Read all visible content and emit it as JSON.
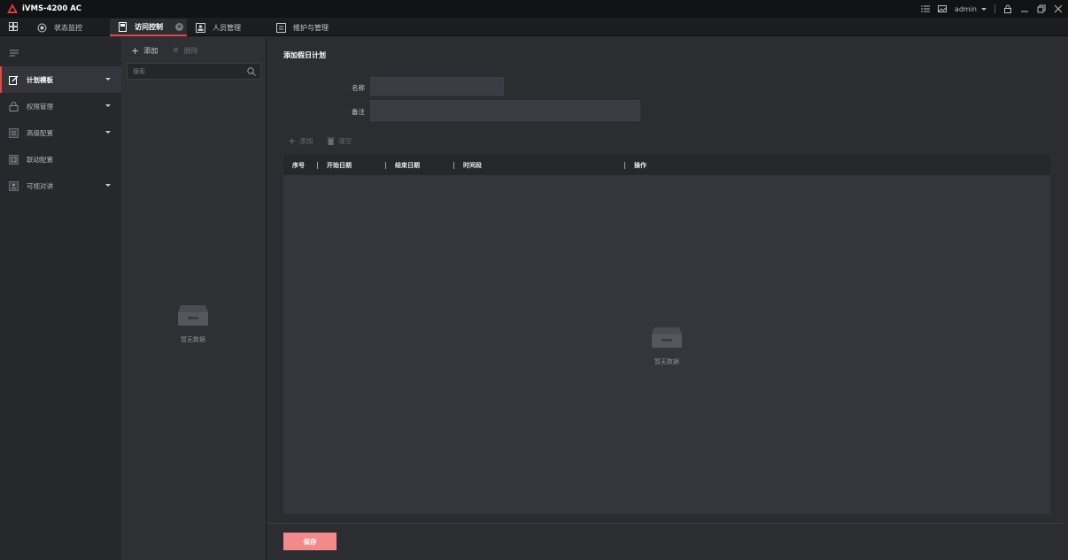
{
  "app": {
    "title": "iVMS-4200 AC",
    "user": "admin"
  },
  "tabs": [
    {
      "label": "状态监控",
      "icon": "monitor-icon"
    },
    {
      "label": "访问控制",
      "icon": "access-control-icon",
      "active": true
    },
    {
      "label": "人员管理",
      "icon": "person-icon"
    },
    {
      "label": "维护与管理",
      "icon": "maintenance-icon"
    }
  ],
  "sidebar": {
    "items": [
      {
        "label": "计划模板",
        "icon": "schedule-icon",
        "active": true,
        "expandable": true
      },
      {
        "label": "权限管理",
        "icon": "lock-icon",
        "expandable": true
      },
      {
        "label": "高级配置",
        "icon": "settings-icon",
        "expandable": true
      },
      {
        "label": "联动配置",
        "icon": "linkage-icon",
        "expandable": false
      },
      {
        "label": "可视对讲",
        "icon": "intercom-icon",
        "expandable": true
      }
    ]
  },
  "list_panel": {
    "add_label": "添加",
    "delete_label": "删除",
    "search_placeholder": "搜索",
    "empty_text": "暂无数据"
  },
  "main": {
    "title": "添加假日计划",
    "form": {
      "name_label": "名称",
      "name_value": "",
      "remark_label": "备注",
      "remark_value": ""
    },
    "grid_toolbar": {
      "add_label": "添加",
      "clear_label": "清空"
    },
    "table": {
      "columns": [
        "序号",
        "开始日期",
        "结束日期",
        "时间段",
        "操作"
      ],
      "rows": [],
      "empty_text": "暂无数据"
    },
    "save_label": "保存"
  },
  "colors": {
    "accent": "#e0474b",
    "save_button": "#f28a8c",
    "background": "#2b2d31"
  }
}
